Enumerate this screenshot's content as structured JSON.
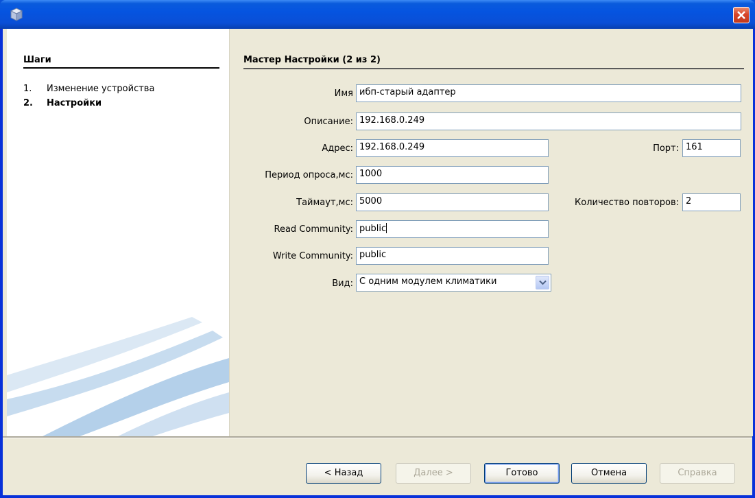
{
  "window": {
    "title": ""
  },
  "steps": {
    "title": "Шаги",
    "items": [
      {
        "num": "1.",
        "label": "Изменение устройства"
      },
      {
        "num": "2.",
        "label": "Настройки"
      }
    ]
  },
  "main": {
    "title": "Мастер Настройки (2 из 2)",
    "fields": {
      "name": {
        "label": "Имя",
        "value": "ибп-старый адаптер"
      },
      "description": {
        "label": "Описание:",
        "value": "192.168.0.249"
      },
      "address": {
        "label": "Адрес:",
        "value": "192.168.0.249"
      },
      "port": {
        "label": "Порт:",
        "value": "161"
      },
      "poll_period": {
        "label": "Период опроса,мс:",
        "value": "1000"
      },
      "timeout": {
        "label": "Таймаут,мс:",
        "value": "5000"
      },
      "retries": {
        "label": "Количество повторов:",
        "value": "2"
      },
      "read_community": {
        "label": "Read Community:",
        "value": "public"
      },
      "write_community": {
        "label": "Write Community:",
        "value": "public"
      },
      "kind": {
        "label": "Вид:",
        "value": "С одним модулем климатики"
      }
    }
  },
  "buttons": {
    "back": "< Назад",
    "next": "Далее >",
    "finish": "Готово",
    "cancel": "Отмена",
    "help": "Справка"
  },
  "colors": {
    "titlebar": "#0554e0",
    "close_button": "#d8452a",
    "dialog_bg": "#ece9d8",
    "field_border": "#7f9db9"
  },
  "icons": {
    "app": "cube-icon",
    "close": "close-icon",
    "dropdown": "chevron-down-icon"
  }
}
